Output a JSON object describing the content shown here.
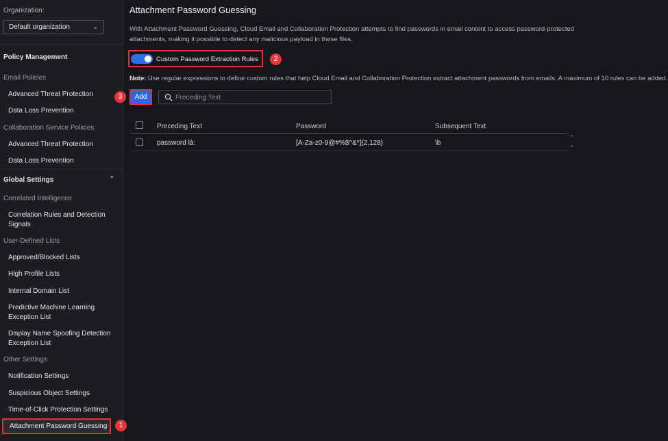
{
  "sidebar": {
    "org_label": "Organization:",
    "org_value": "Default organization",
    "policy_heading": "Policy Management",
    "email_group": "Email Policies",
    "email_items": [
      "Advanced Threat Protection",
      "Data Loss Prevention"
    ],
    "collab_group": "Collaboration Service Policies",
    "collab_items": [
      "Advanced Threat Protection",
      "Data Loss Prevention"
    ],
    "global_heading": "Global Settings",
    "correlated_group": "Correlated Intelligence",
    "correlated_items": [
      "Correlation Rules and Detection Signals"
    ],
    "userlists_group": "User-Defined Lists",
    "userlists_items": [
      "Approved/Blocked Lists",
      "High Profile Lists",
      "Internal Domain List",
      "Predictive Machine Learning Exception List",
      "Display Name Spoofing Detection Exception List"
    ],
    "other_group": "Other Settings",
    "other_items": [
      "Notification Settings",
      "Suspicious Object Settings",
      "Time-of-Click Protection Settings",
      "Attachment Password Guessing"
    ]
  },
  "callouts": [
    "1",
    "2",
    "3"
  ],
  "main": {
    "title": "Attachment Password Guessing",
    "description": "With Attachment Password Guessing, Cloud Email and Collaboration Protection attempts to find passwords in email content to access password-protected attachments, making it possible to detect any malicious payload in these files.",
    "toggle_label": "Custom Password Extraction Rules",
    "toggle_on": true,
    "note_label": "Note:",
    "note_text": " Use regular expressions to define custom rules that help Cloud Email and Collaboration Protection extract attachment passwords from emails. A maximum of 10 rules can be added.",
    "add_label": "Add",
    "search_placeholder": "Preceding Text"
  },
  "table": {
    "headers": [
      "Preceding Text",
      "Password",
      "Subsequent Text"
    ],
    "rows": [
      {
        "preceding": "password là:",
        "password": "[A-Za-z0-9@#%$^&*]{2,128}",
        "subsequent": "\\b"
      }
    ]
  },
  "colors": {
    "accent": "#2868e0",
    "callout": "#e8343c",
    "background": "#16171a"
  }
}
